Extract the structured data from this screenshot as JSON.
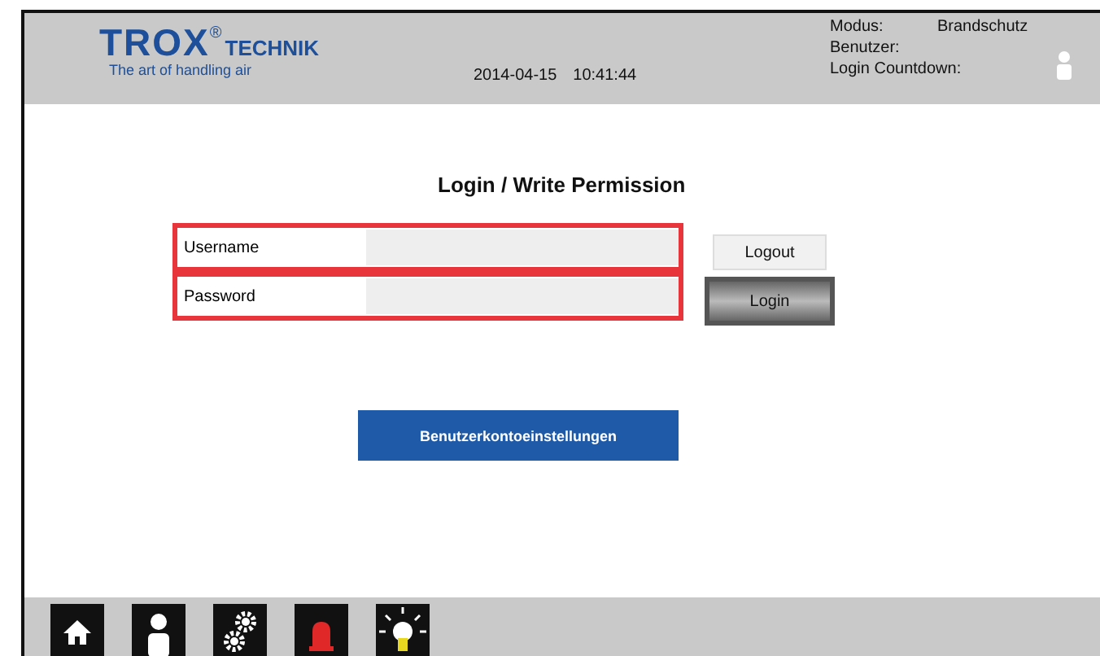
{
  "header": {
    "logo": {
      "brand": "TROX",
      "mark": "®",
      "suffix": "TECHNIK",
      "tagline": "The art of handling air"
    },
    "date": "2014-04-15",
    "time": "10:41:44",
    "status": [
      {
        "label": "Modus:",
        "value": "Brandschutz"
      },
      {
        "label": "Benutzer:"
      },
      {
        "label": "Login Countdown:"
      }
    ]
  },
  "title": "Login / Write Permission",
  "fields": [
    {
      "label": "Username",
      "highlighted": true
    },
    {
      "label": "Password",
      "highlighted": true
    }
  ],
  "buttons": [
    {
      "label": "Logout",
      "kind": "plain",
      "highlighted": false
    },
    {
      "label": "Login",
      "kind": "dark",
      "highlighted": true
    }
  ],
  "account_button": "Benutzerkontoeinstellungen",
  "nav": [
    {
      "kind": "home"
    },
    {
      "kind": "user"
    },
    {
      "kind": "gears"
    },
    {
      "kind": "alarm"
    },
    {
      "kind": "light"
    }
  ]
}
